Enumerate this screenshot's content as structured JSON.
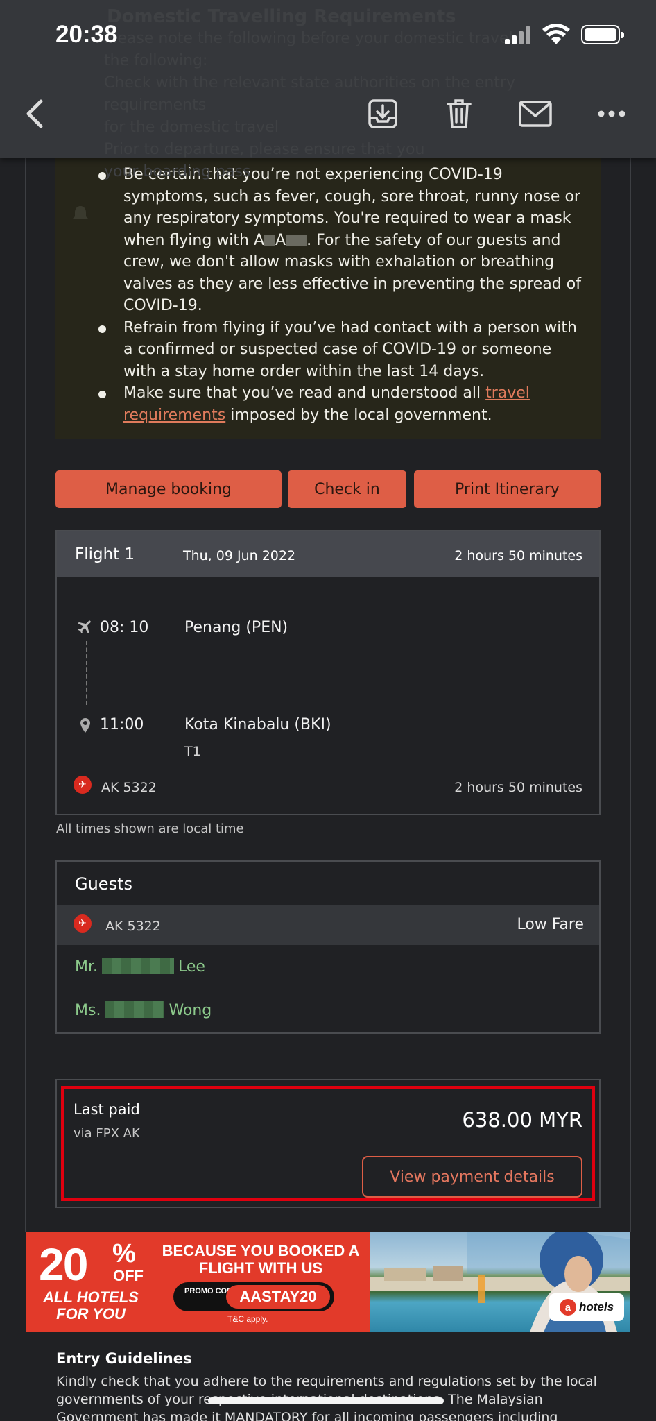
{
  "status_bar": {
    "time": "20:38"
  },
  "background_text": {
    "heading": "Domestic Travelling Requirements",
    "lines": [
      "Please note the following before your domestic travel",
      "the following:",
      "Check with the relevant state authorities on the entry requirements",
      "for the domestic travel",
      "Prior to departure, please ensure that you",
      "your boarding pass"
    ]
  },
  "toolbar": {
    "back_icon": "chevron-left-icon",
    "archive_icon": "archive-icon",
    "delete_icon": "trash-icon",
    "mail_icon": "mail-icon",
    "more_icon": "more-horizontal-icon"
  },
  "notice": {
    "bullet1_pre": "Be certain that you’re not experiencing COVID-19 symptoms, such as fever, cough, sore throat, runny nose or any respiratory symptoms. You're required to wear a mask when flying with A",
    "bullet1_mid": "A",
    "bullet1_post": ". For the safety of our guests and crew, we don't allow masks with exhalation or breathing valves as they are less effective in preventing the spread of COVID-19.",
    "bullet2": "Refrain from flying if you’ve had contact with a person with a confirmed or suspected case of COVID-19 or someone with a stay home order within the last 14 days.",
    "bullet3_pre": "Make sure that you’ve read and understood all ",
    "bullet3_link": "travel requirements",
    "bullet3_post": " imposed by the local government."
  },
  "actions": {
    "manage_booking": "Manage booking",
    "check_in": "Check in",
    "print_itinerary": "Print Itinerary"
  },
  "flight": {
    "title": "Flight 1",
    "date": "Thu, 09 Jun 2022",
    "duration": "2 hours 50 minutes",
    "depart_time": "08: 10",
    "depart_airport": "Penang (PEN)",
    "arrive_time": "11:00",
    "arrive_airport": "Kota Kinabalu (BKI)",
    "terminal": "T1",
    "flight_number": "AK 5322",
    "flight_duration": "2 hours 50 minutes",
    "note": "All times shown are local time"
  },
  "guests": {
    "title": "Guests",
    "flight_number": "AK 5322",
    "fare": "Low Fare",
    "guest1_title": "Mr.",
    "guest1_last": "Lee",
    "guest2_title": "Ms.",
    "guest2_last": "Wong"
  },
  "payment": {
    "label": "Last paid",
    "method": "via FPX AK",
    "amount": "638.00 MYR",
    "details_button": "View payment details"
  },
  "banner": {
    "percent": "20",
    "percent_sign": "%",
    "off": "OFF",
    "all_hotels": "ALL HOTELS FOR YOU",
    "because": "BECAUSE YOU BOOKED A FLIGHT WITH US",
    "promo_label": "PROMO CODE",
    "promo_code": "AASTAY20",
    "tc": "T&C apply.",
    "hotels": "hotels",
    "hotels_logo": "a",
    "colors": {
      "brand_red": "#e23a2a"
    }
  },
  "entry": {
    "title": "Entry Guidelines",
    "body": "Kindly check that you adhere to the requirements and regulations set by the local governments of your respective international destinations. The Malaysian Government has made it MANDATORY for all incoming passengers including"
  },
  "colors": {
    "accent": "#de5e46",
    "highlight_box": "#e0000f",
    "guest_name": "#8cc98b"
  }
}
